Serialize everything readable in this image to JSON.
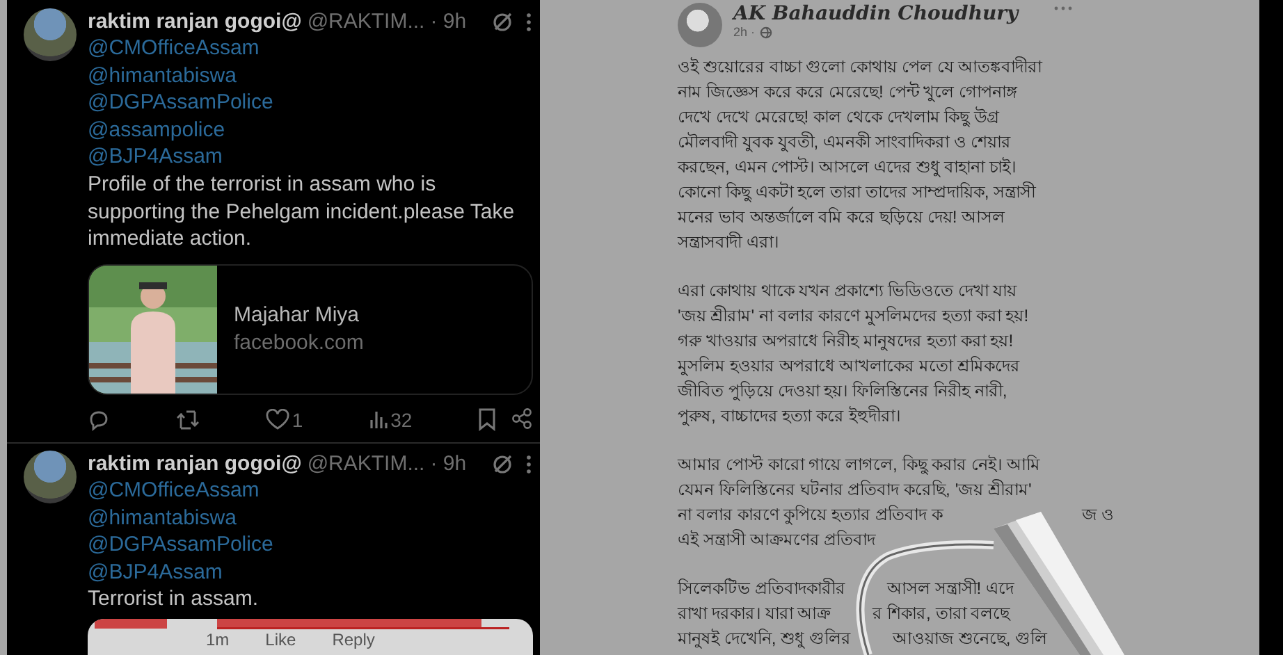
{
  "tweets": [
    {
      "author": "raktim ranjan gogoi@",
      "handle": "@RAKTIM...",
      "time": "· 9h",
      "mentions": [
        "@CMOfficeAssam",
        "@himantabiswa",
        "@DGPAssamPolice",
        "@assampolice",
        "@BJP4Assam"
      ],
      "text": "Profile of the terrorist in assam who is supporting the Pehelgam incident.please Take immediate action.",
      "attachment": {
        "kind": "link",
        "title": "Majahar Miya",
        "domain": "facebook.com"
      },
      "likes": "1",
      "views": "32"
    },
    {
      "author": "raktim ranjan gogoi@",
      "handle": "@RAKTIM...",
      "time": "· 9h",
      "mentions": [
        "@CMOfficeAssam",
        "@himantabiswa",
        "@DGPAssamPolice",
        "@BJP4Assam"
      ],
      "text": "Terrorist in assam.",
      "attachment": {
        "kind": "screenshot",
        "items": [
          "1m",
          "Like",
          "Reply"
        ]
      }
    }
  ],
  "post": {
    "author": "AK Bahauddin Choudhury",
    "time": "2h ·",
    "paragraphs": [
      [
        [
          "ওই শুয়োরের বাচ্চা গুলো কোথায় পেল যে আতঙ্কবাদীরা"
        ],
        [
          "নাম জিজ্ঞেস করে করে মেরেছে! পেন্ট খুলে গোপনাঙ্গ"
        ],
        [
          "দেখে দেখে মেরেছে! কাল থেকে দেখলাম কিছু উগ্র"
        ],
        [
          "মৌলবাদী যুবক যুবতী, এমনকী সাংবাদিকরা ও শেয়ার"
        ],
        [
          "করছেন, এমন পোস্ট। আসলে এদের শুধু বাহানা চাই।"
        ],
        [
          "কোনো কিছু একটা হলে তারা তাদের সাম্প্রদায়িক, সন্ত্রাসী"
        ],
        [
          "মনের ভাব অন্তর্জালে বমি করে ছড়িয়ে দেয়! আসল"
        ],
        [
          "সন্ত্রাসবাদী এরা।"
        ]
      ],
      [
        [
          "এরা কোথায় থাকে যখন প্রকাশ্যে ভিডিওতে দেখা যায়"
        ],
        [
          "'জয় শ্রীরাম' না বলার কারণে মুসলিমদের হত্যা করা হয়!"
        ],
        [
          "গরু খাওয়ার অপরাধে নিরীহ মানুষদের হত্যা করা হয়!"
        ],
        [
          "মুসলিম হওয়ার অপরাধে আখলাকের মতো শ্রমিকদের"
        ],
        [
          "জীবিত পুড়িয়ে দেওয়া হয়। ফিলিস্তিনের নিরীহ নারী,"
        ],
        [
          "পুরুষ, বাচ্চাদের হত্যা করে ইহুদীরা।"
        ]
      ],
      [
        [
          "আমার পোস্ট কারো গায়ে লাগলে, কিছু করার নেই।  আমি"
        ],
        [
          "যেমন ফিলিস্তিনের ঘটনার প্রতিবাদ করেছি, 'জয় শ্রীরাম'"
        ],
        [
          "না বলার কারণে কুপিয়ে হত্যার প্রতিবাদ ক",
          "জ ও"
        ],
        [
          "এই সন্ত্রাসী আক্রমণের প্রতিবাদ"
        ]
      ],
      [
        [
          "সিলেকটিভ প্রতিবাদকারীর",
          "আসল সন্ত্রাসী! এদে"
        ],
        [
          "রাখা দরকার। যারা আক্র",
          "র শিকার, তারা বলছে"
        ],
        [
          "মানুষই দেখেনি, শুধু গুলির",
          "আওয়াজ শুনেছে, গুলি"
        ]
      ]
    ]
  }
}
